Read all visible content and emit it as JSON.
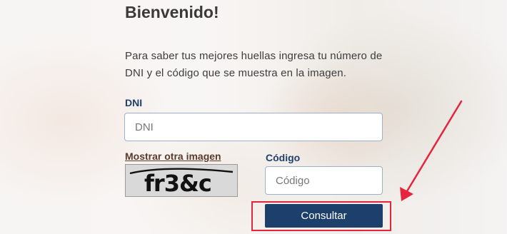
{
  "form": {
    "title": "Bienvenido!",
    "intro": "Para saber tus mejores huellas ingresa tu número de DNI y el código que se muestra en la imagen.",
    "dni_label": "DNI",
    "dni_placeholder": "DNI",
    "refresh_captcha_label": "Mostrar otra imagen",
    "captcha_text": "fr3&c",
    "codigo_label": "Código",
    "codigo_placeholder": "Código",
    "submit_label": "Consultar"
  },
  "colors": {
    "label": "#22406b",
    "button": "#1c3f6b",
    "annotation": "#e5253e"
  }
}
